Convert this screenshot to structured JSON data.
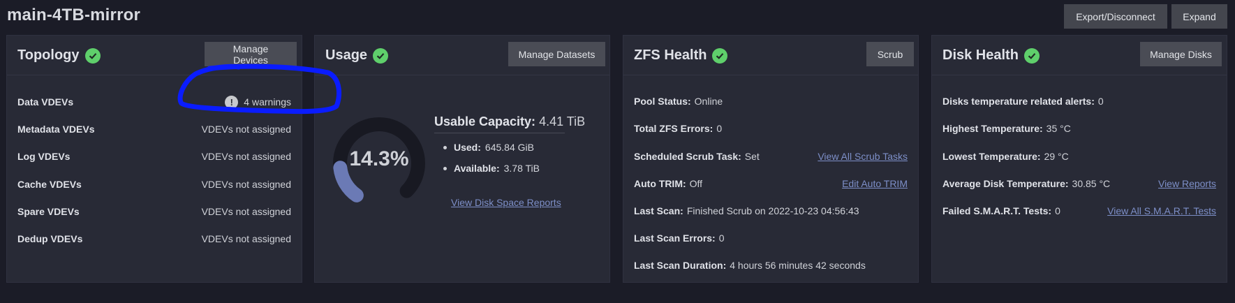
{
  "pool": {
    "title": "main-4TB-mirror"
  },
  "header_actions": {
    "export_label": "Export/Disconnect",
    "expand_label": "Expand"
  },
  "topology": {
    "title": "Topology",
    "button": "Manage Devices",
    "rows": [
      {
        "label": "Data VDEVs",
        "value": "4 warnings"
      },
      {
        "label": "Metadata VDEVs",
        "value": "VDEVs not assigned"
      },
      {
        "label": "Log VDEVs",
        "value": "VDEVs not assigned"
      },
      {
        "label": "Cache VDEVs",
        "value": "VDEVs not assigned"
      },
      {
        "label": "Spare VDEVs",
        "value": "VDEVs not assigned"
      },
      {
        "label": "Dedup VDEVs",
        "value": "VDEVs not assigned"
      }
    ],
    "warning_glyph": "!"
  },
  "usage": {
    "title": "Usage",
    "button": "Manage Datasets",
    "percent_text": "14.3%",
    "percent_value": 0.143,
    "capacity_label": "Usable Capacity:",
    "capacity_value": "4.41 TiB",
    "used_label": "Used:",
    "used_value": "645.84 GiB",
    "available_label": "Available:",
    "available_value": "3.78 TiB",
    "report_link": "View Disk Space Reports",
    "gauge_color": "#6b7ab5",
    "track_color": "#181922"
  },
  "zfs": {
    "title": "ZFS Health",
    "button": "Scrub",
    "pool_status_label": "Pool Status:",
    "pool_status": "Online",
    "errors_label": "Total ZFS Errors:",
    "errors": "0",
    "scrub_task_label": "Scheduled Scrub Task:",
    "scrub_task": "Set",
    "scrub_task_link": "View All Scrub Tasks",
    "trim_label": "Auto TRIM:",
    "trim": "Off",
    "trim_link": "Edit Auto TRIM",
    "last_scan_label": "Last Scan:",
    "last_scan": "Finished Scrub on 2022-10-23 04:56:43",
    "last_scan_errors_label": "Last Scan Errors:",
    "last_scan_errors": "0",
    "last_scan_duration_label": "Last Scan Duration:",
    "last_scan_duration": "4 hours 56 minutes 42 seconds"
  },
  "disk": {
    "title": "Disk Health",
    "button": "Manage Disks",
    "temp_alerts_label": "Disks temperature related alerts:",
    "temp_alerts": "0",
    "highest_label": "Highest Temperature:",
    "highest": "35 °C",
    "lowest_label": "Lowest Temperature:",
    "lowest": "29 °C",
    "average_label": "Average Disk Temperature:",
    "average": "30.85 °C",
    "reports_link": "View Reports",
    "smart_label": "Failed S.M.A.R.T. Tests:",
    "smart": "0",
    "smart_link": "View All S.M.A.R.T. Tests"
  },
  "colors": {
    "accent_check": "#5fcf6b",
    "link": "#7d8fc8",
    "annotation": "#0a1cff"
  }
}
